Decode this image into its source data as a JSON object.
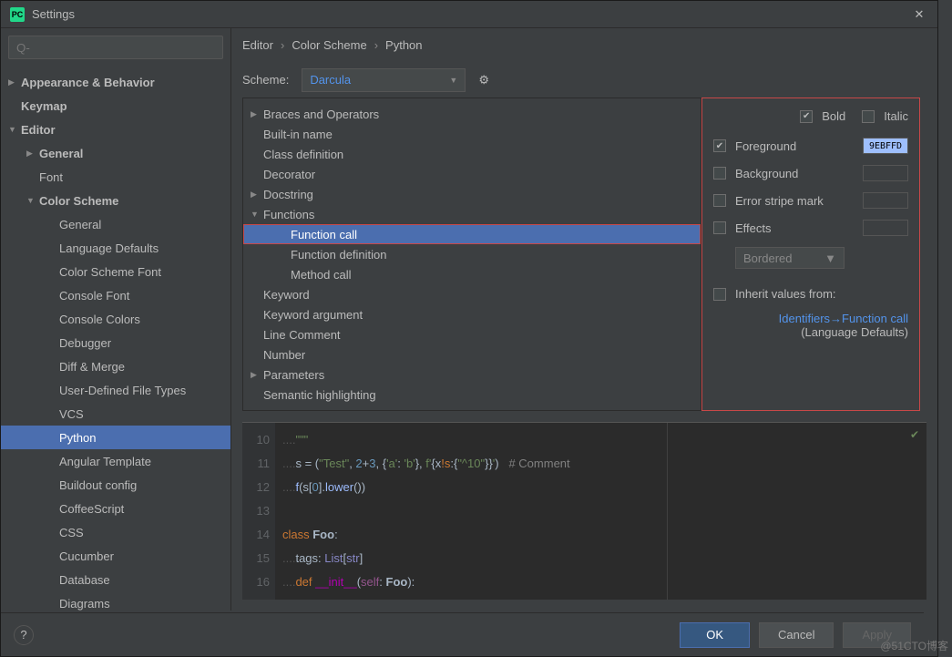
{
  "window": {
    "title": "Settings",
    "app_badge": "PC"
  },
  "search": {
    "placeholder": "Q-"
  },
  "sidebar": {
    "items": [
      {
        "label": "Appearance & Behavior",
        "depth": 0,
        "arrow": "▶",
        "bold": true
      },
      {
        "label": "Keymap",
        "depth": 0,
        "bold": true
      },
      {
        "label": "Editor",
        "depth": 0,
        "arrow": "▼",
        "bold": true
      },
      {
        "label": "General",
        "depth": 1,
        "arrow": "▶",
        "bold": true
      },
      {
        "label": "Font",
        "depth": 1
      },
      {
        "label": "Color Scheme",
        "depth": 1,
        "arrow": "▼",
        "bold": true
      },
      {
        "label": "General",
        "depth": 2
      },
      {
        "label": "Language Defaults",
        "depth": 2
      },
      {
        "label": "Color Scheme Font",
        "depth": 2
      },
      {
        "label": "Console Font",
        "depth": 2
      },
      {
        "label": "Console Colors",
        "depth": 2
      },
      {
        "label": "Debugger",
        "depth": 2
      },
      {
        "label": "Diff & Merge",
        "depth": 2
      },
      {
        "label": "User-Defined File Types",
        "depth": 2
      },
      {
        "label": "VCS",
        "depth": 2
      },
      {
        "label": "Python",
        "depth": 2,
        "selected": true
      },
      {
        "label": "Angular Template",
        "depth": 2
      },
      {
        "label": "Buildout config",
        "depth": 2
      },
      {
        "label": "CoffeeScript",
        "depth": 2
      },
      {
        "label": "CSS",
        "depth": 2
      },
      {
        "label": "Cucumber",
        "depth": 2
      },
      {
        "label": "Database",
        "depth": 2
      },
      {
        "label": "Diagrams",
        "depth": 2
      }
    ]
  },
  "breadcrumb": [
    "Editor",
    "Color Scheme",
    "Python"
  ],
  "scheme": {
    "label": "Scheme:",
    "value": "Darcula"
  },
  "categories": [
    {
      "label": "Braces and Operators",
      "depth": 0,
      "arrow": "▶"
    },
    {
      "label": "Built-in name",
      "depth": 0
    },
    {
      "label": "Class definition",
      "depth": 0
    },
    {
      "label": "Decorator",
      "depth": 0
    },
    {
      "label": "Docstring",
      "depth": 0,
      "arrow": "▶"
    },
    {
      "label": "Functions",
      "depth": 0,
      "arrow": "▼"
    },
    {
      "label": "Function call",
      "depth": 1,
      "selected": true,
      "highlighted": true
    },
    {
      "label": "Function definition",
      "depth": 1
    },
    {
      "label": "Method call",
      "depth": 1
    },
    {
      "label": "Keyword",
      "depth": 0
    },
    {
      "label": "Keyword argument",
      "depth": 0
    },
    {
      "label": "Line Comment",
      "depth": 0
    },
    {
      "label": "Number",
      "depth": 0
    },
    {
      "label": "Parameters",
      "depth": 0,
      "arrow": "▶"
    },
    {
      "label": "Semantic highlighting",
      "depth": 0
    }
  ],
  "props": {
    "bold_label": "Bold",
    "bold_checked": true,
    "italic_label": "Italic",
    "italic_checked": false,
    "foreground_label": "Foreground",
    "foreground_checked": true,
    "foreground_color": "9EBFFD",
    "background_label": "Background",
    "background_checked": false,
    "errorstripe_label": "Error stripe mark",
    "errorstripe_checked": false,
    "effects_label": "Effects",
    "effects_checked": false,
    "effects_value": "Bordered",
    "inherit_label": "Inherit values from:",
    "inherit_link": "Identifiers→Function call",
    "inherit_sub": "(Language Defaults)"
  },
  "preview": {
    "line_nums": [
      "10",
      "11",
      "12",
      "13",
      "14",
      "15",
      "16"
    ]
  },
  "footer": {
    "ok": "OK",
    "cancel": "Cancel",
    "apply": "Apply"
  },
  "watermark": "@51CTO博客"
}
